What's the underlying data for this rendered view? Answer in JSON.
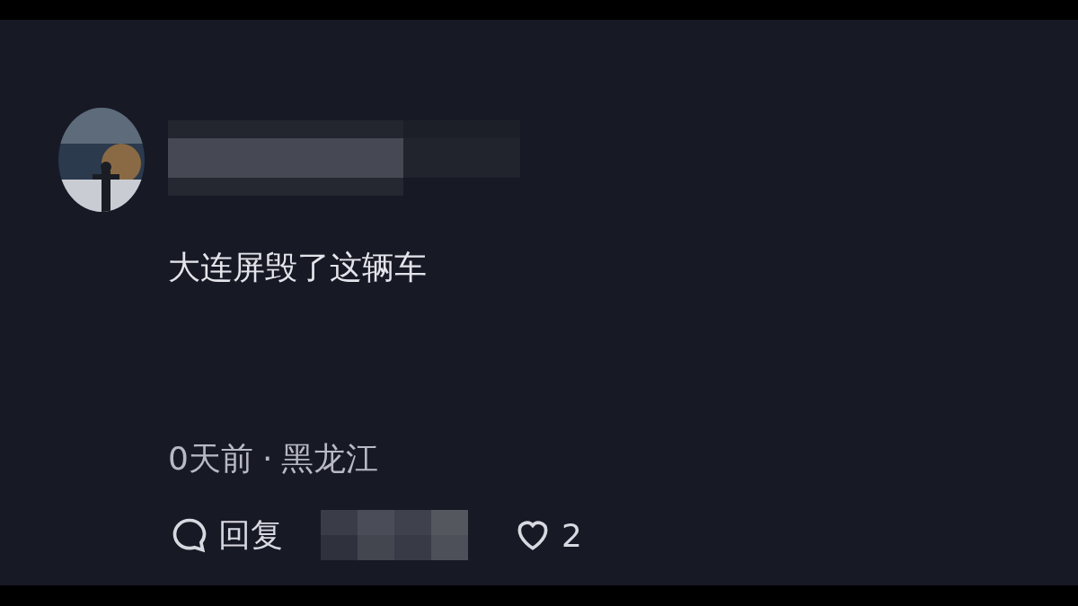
{
  "comment": {
    "text": "大连屏毁了这辆车",
    "time": "0天前",
    "separator": "·",
    "location": "黑龙江",
    "reply_label": "回复",
    "likes": "2"
  }
}
